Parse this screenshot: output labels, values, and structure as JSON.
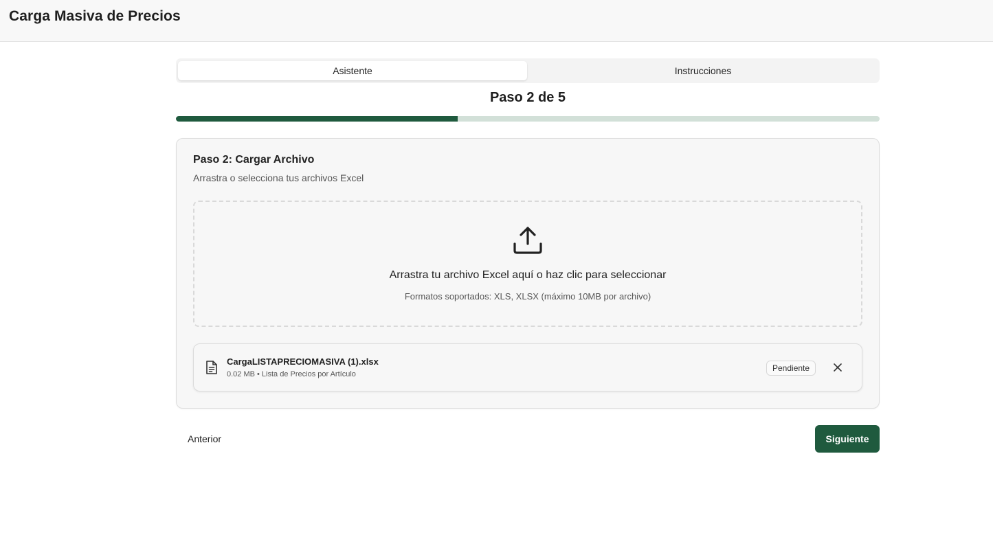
{
  "header": {
    "title": "Carga Masiva de Precios"
  },
  "tabs": [
    {
      "label": "Asistente",
      "active": true
    },
    {
      "label": "Instrucciones",
      "active": false
    }
  ],
  "wizard": {
    "step_label": "Paso 2 de 5",
    "progress_fraction": 0.4,
    "accent_color": "#1f5a3e",
    "track_color": "#d2e0d8"
  },
  "card": {
    "title": "Paso 2: Cargar Archivo",
    "subtitle": "Arrastra o selecciona tus archivos Excel",
    "dropzone": {
      "icon": "upload-icon",
      "main_text": "Arrastra tu archivo Excel aquí o haz clic para seleccionar",
      "sub_text": "Formatos soportados: XLS, XLSX (máximo 10MB por archivo)"
    },
    "file": {
      "icon": "file-text-icon",
      "name": "CargaLISTAPRECIOMASIVA (1).xlsx",
      "meta": "0.02 MB • Lista de Precios por Artículo",
      "status": "Pendiente",
      "remove_icon": "close-icon"
    }
  },
  "footer": {
    "prev_label": "Anterior",
    "next_label": "Siguiente"
  }
}
